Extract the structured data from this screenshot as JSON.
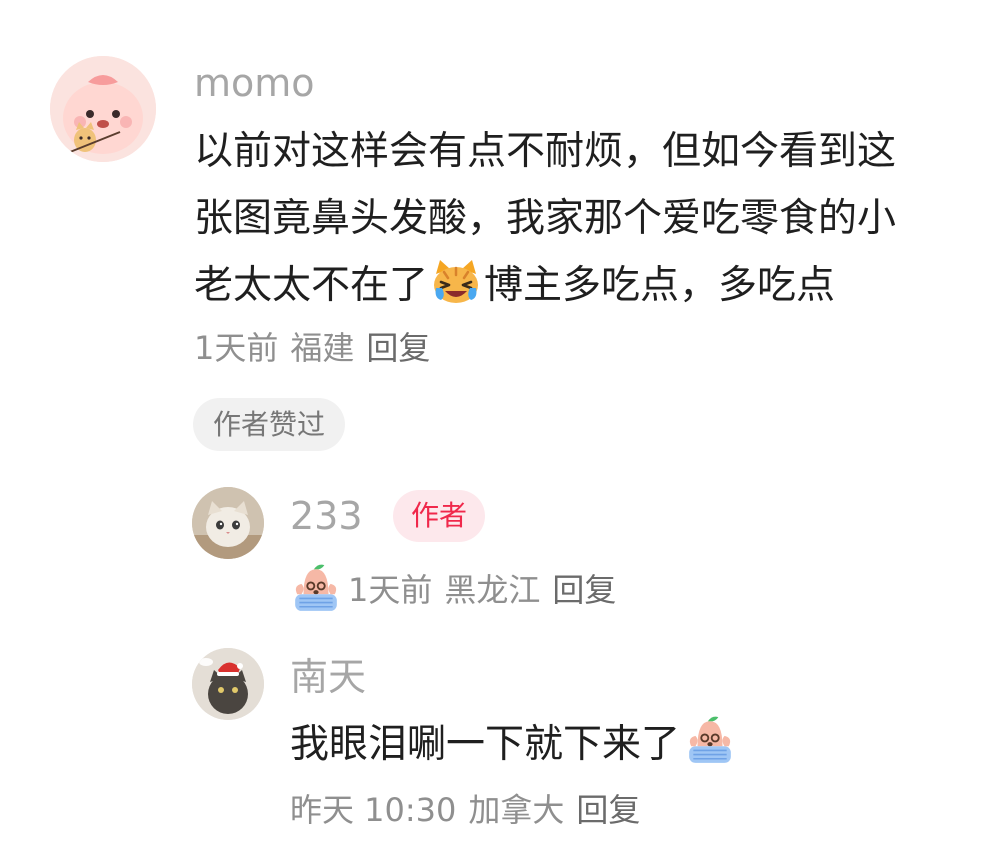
{
  "main_comment": {
    "username": "momo",
    "lines": [
      "以前对这样会有点不耐烦，但如今看到这",
      "张图竟鼻头发酸，我家那个爱吃零食的小",
      "老太太不在了",
      "博主多吃点，多吃点"
    ],
    "time": "1天前",
    "location": "福建",
    "reply_label": "回复",
    "liked_badge": "作者赞过"
  },
  "replies": [
    {
      "username": "233",
      "author_badge": "作者",
      "time": "1天前",
      "location": "黑龙江",
      "reply_label": "回复"
    },
    {
      "username": "南天",
      "text": "我眼泪唰一下就下来了",
      "time": "昨天 10:30",
      "location": "加拿大",
      "reply_label": "回复"
    }
  ],
  "icons": {
    "crying_cat": "crying-cat-emoji",
    "crying_peach": "crying-peach-emoji"
  },
  "colors": {
    "author_badge_text": "#f0284b",
    "author_badge_bg": "#fde8ec",
    "username": "#a6a6a6",
    "text": "#1f1f1f"
  }
}
